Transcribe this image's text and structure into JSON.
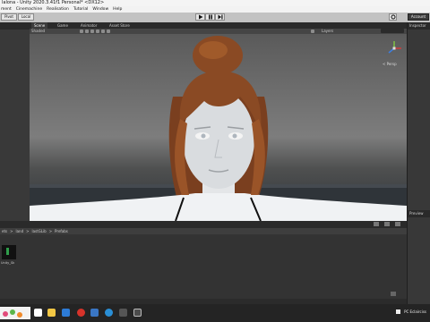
{
  "window": {
    "title": "lalona - Unity 2020.3.41f1 Personal* <DX12>"
  },
  "menu": [
    "ment",
    "Cinemachine",
    "Realisation",
    "Tutorial",
    "Window",
    "Help"
  ],
  "toolbar": {
    "pivot_label": "Pivot",
    "local_label": "Local",
    "account_label": "Account",
    "layers_label": "Layers"
  },
  "scene_tabs": [
    "Scene",
    "Game",
    "Animator",
    "Asset Store"
  ],
  "scene": {
    "shading_mode": "Shaded",
    "gizmos_label": "Gizmos",
    "perspective_label": "< Persp"
  },
  "right_panel": {
    "inspector_tab": "Inspector",
    "preview_tab": "Preview"
  },
  "project": {
    "breadcrumb": [
      "ets",
      ">",
      "land",
      ">",
      "lastGLib",
      ">",
      "Prefabs"
    ],
    "asset_label": "Unity_Sk"
  },
  "taskbar": {
    "tray_text": "PC  Eclairciss"
  },
  "colors": {
    "editor_bg": "#393939",
    "scene_sky": "#7d7d7d",
    "gizmo_x": "#d23b3b",
    "gizmo_y": "#7fc242",
    "gizmo_z": "#3d7ee0",
    "hair": "#8a4a24"
  }
}
